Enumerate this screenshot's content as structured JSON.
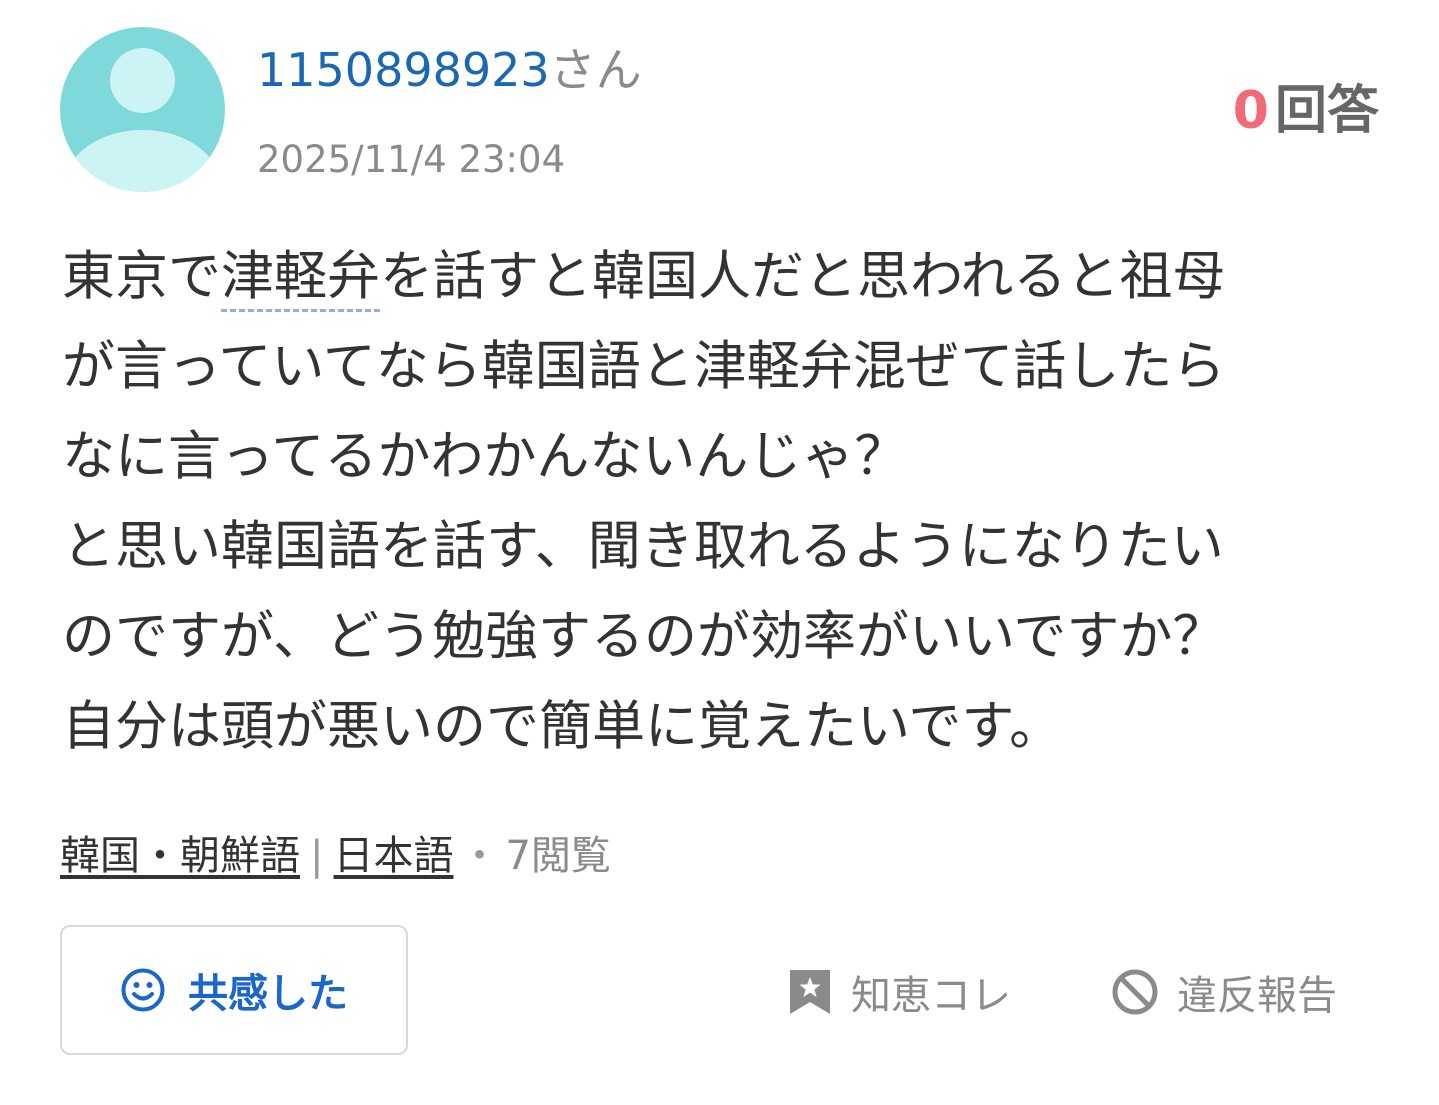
{
  "question": {
    "user": {
      "id": "1150898923",
      "suffix": "さん",
      "avatar_icon": "default-avatar-icon"
    },
    "timestamp": "2025/11/4 23:04",
    "answers": {
      "count": "0",
      "label": "回答"
    },
    "body": {
      "line1_before": "東京で",
      "line1_keyword": "津軽弁",
      "line1_after": "を話すと韓国人だと思われると祖母",
      "line2": "が言っていてなら韓国語と津軽弁混ぜて話したら",
      "line3": "なに言ってるかわかんないんじゃ？",
      "line4": "と思い韓国語を話す、聞き取れるようになりたい",
      "line5": "のですが、どう勉強するのが効率がいいですか？",
      "line6": "自分は頭が悪いので簡単に覚えたいです。"
    },
    "meta": {
      "category1": "韓国・朝鮮語",
      "separator": "|",
      "category2": "日本語",
      "dot": "・",
      "views": "7閲覧"
    }
  },
  "actions": {
    "empathy": {
      "label": "共感した",
      "icon": "smile-icon",
      "color": "#1a67c9"
    },
    "chie_collection": {
      "label": "知恵コレ",
      "icon": "bookmark-star-icon"
    },
    "report": {
      "label": "違反報告",
      "icon": "prohibited-icon"
    }
  },
  "colors": {
    "user_link": "#1a67b3",
    "answer_count": "#f06a78",
    "avatar_bg": "#7fd9db",
    "avatar_fg": "#cdf4f4",
    "muted_text": "#8a8a8a",
    "body_text": "#333333"
  }
}
